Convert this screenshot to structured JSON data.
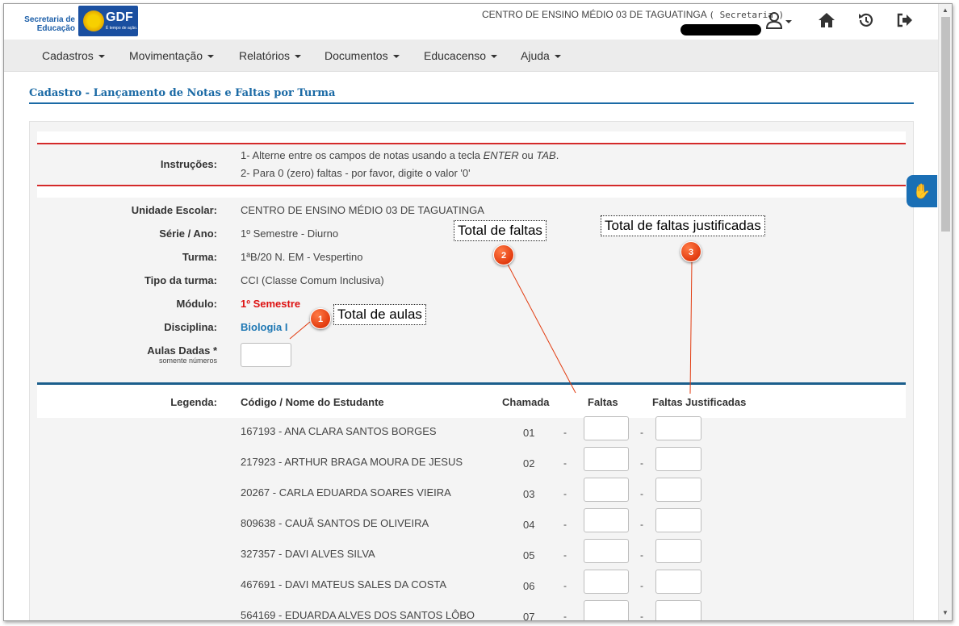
{
  "header": {
    "logo_secretaria": "Secretaria de Educação",
    "logo_gdf": "GDF",
    "logo_gdf_sub": "É tempo de ação.",
    "school": "CENTRO DE ENSINO MÉDIO 03 DE TAGUATINGA",
    "role": "( Secretaria )"
  },
  "menu": {
    "items": [
      "Cadastros",
      "Movimentação",
      "Relatórios",
      "Documentos",
      "Educacenso",
      "Ajuda"
    ]
  },
  "page_title": "Cadastro - Lançamento de Notas e Faltas por Turma",
  "instructions": {
    "label": "Instruções:",
    "line1_pre": "1- Alterne entre os campos de notas usando a tecla ",
    "line1_enter": "ENTER",
    "line1_mid": " ou ",
    "line1_tab": "TAB",
    "line1_post": ".",
    "line2": "2- Para 0 (zero) faltas - por favor, digite o valor '0'"
  },
  "info": {
    "unidade_label": "Unidade Escolar:",
    "unidade": "CENTRO DE ENSINO MÉDIO 03 DE TAGUATINGA",
    "serie_label": "Série / Ano:",
    "serie": "1º Semestre - Diurno",
    "turma_label": "Turma:",
    "turma": "1ªB/20 N. EM - Vespertino",
    "tipo_label": "Tipo da turma:",
    "tipo": "CCI (Classe Comum Inclusiva)",
    "modulo_label": "Módulo:",
    "modulo": "1º Semestre",
    "disciplina_label": "Disciplina:",
    "disciplina": "Biologia I",
    "aulas_label": "Aulas Dadas *",
    "aulas_sub": "somente números",
    "aulas_value": ""
  },
  "table": {
    "legenda": "Legenda:",
    "col_nome": "Código / Nome do Estudante",
    "col_chamada": "Chamada",
    "col_faltas": "Faltas",
    "col_justificadas": "Faltas Justificadas",
    "dash": "-",
    "students": [
      {
        "name": "167193 - ANA CLARA SANTOS BORGES",
        "chamada": "01"
      },
      {
        "name": "217923 - ARTHUR BRAGA MOURA DE JESUS",
        "chamada": "02"
      },
      {
        "name": "20267 - CARLA EDUARDA SOARES VIEIRA",
        "chamada": "03"
      },
      {
        "name": "809638 - CAUÃ SANTOS DE OLIVEIRA",
        "chamada": "04"
      },
      {
        "name": "327357 - DAVI ALVES SILVA",
        "chamada": "05"
      },
      {
        "name": "467691 - DAVI MATEUS SALES DA COSTA",
        "chamada": "06"
      },
      {
        "name": "564169 - EDUARDA ALVES DOS SANTOS LÔBO",
        "chamada": "07"
      }
    ]
  },
  "annotations": {
    "total_aulas": "Total de aulas",
    "total_faltas": "Total de faltas",
    "total_justificadas": "Total de faltas justificadas",
    "n1": "1",
    "n2": "2",
    "n3": "3"
  },
  "colors": {
    "accent_blue": "#1b6aa5",
    "alert_red": "#d42a2a",
    "badge_orange": "#e23c10"
  }
}
